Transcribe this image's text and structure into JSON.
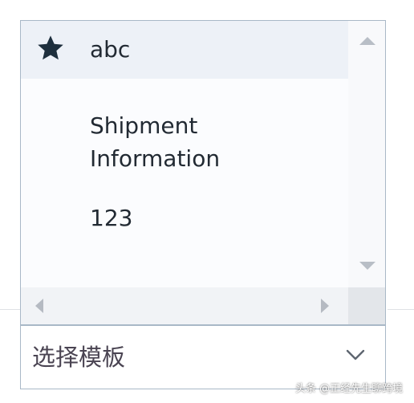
{
  "listbox": {
    "items": [
      {
        "label": "abc",
        "icon": "star-icon",
        "selected": true
      },
      {
        "label_lines": [
          "Shipment",
          "Information"
        ]
      },
      {
        "label": "123"
      }
    ]
  },
  "template_select": {
    "value": "选择模板",
    "icon": "chevron-down-icon"
  },
  "watermark": {
    "text": "头条 @正经先生聊跨境"
  },
  "colors": {
    "border": "#a9b8c7",
    "selected_row": "#edf1f7",
    "text": "#222a33",
    "scroll_arrow": "#b8bec6"
  }
}
